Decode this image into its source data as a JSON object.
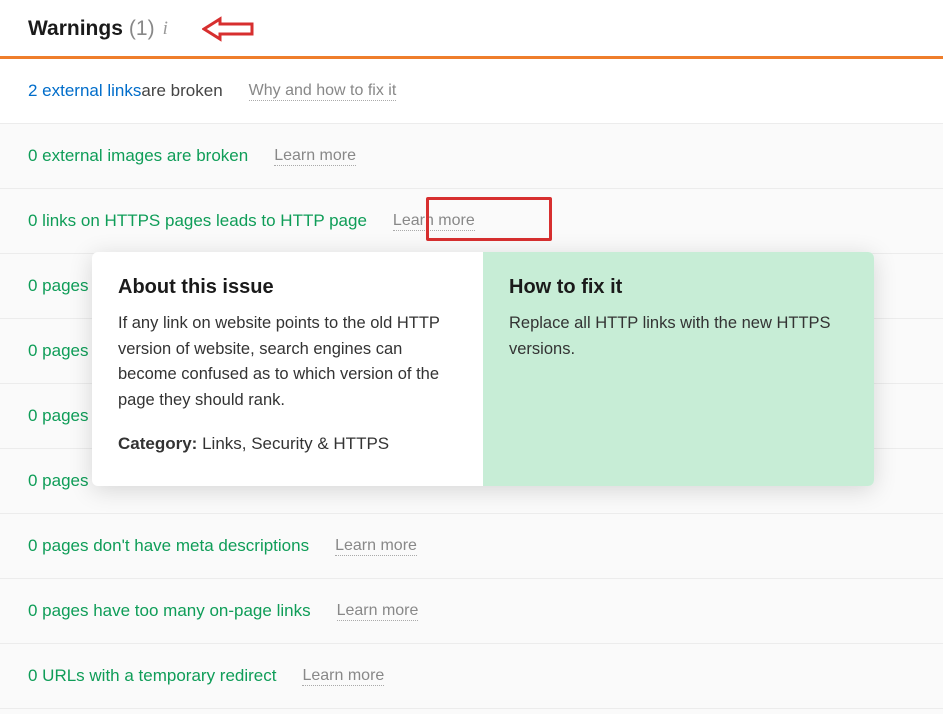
{
  "header": {
    "title": "Warnings",
    "count": "(1)"
  },
  "rows": [
    {
      "count_text": "2 external links",
      "suffix": " are broken",
      "action": "Why and how to fix it",
      "is_link": true
    },
    {
      "count_text": "0 external images are broken",
      "action": "Learn more",
      "is_link": false
    },
    {
      "count_text": "0 links on HTTPS pages leads to HTTP page",
      "action": "Learn more",
      "is_link": false,
      "highlighted": true
    },
    {
      "count_text": "0 pages",
      "action": "",
      "is_link": false
    },
    {
      "count_text": "0 pages",
      "action": "",
      "is_link": false
    },
    {
      "count_text": "0 pages",
      "action": "",
      "is_link": false
    },
    {
      "count_text": "0 pages",
      "action": "",
      "is_link": false
    },
    {
      "count_text": "0 pages don't have meta descriptions",
      "action": "Learn more",
      "is_link": false
    },
    {
      "count_text": "0 pages have too many on-page links",
      "action": "Learn more",
      "is_link": false
    },
    {
      "count_text": "0 URLs with a temporary redirect",
      "action": "Learn more",
      "is_link": false
    }
  ],
  "tooltip": {
    "about_title": "About this issue",
    "about_body": "If any link on website points to the old HTTP version of website, search engines can become confused as to which version of the page they should rank.",
    "category_label": "Category:",
    "category_value": " Links, Security & HTTPS",
    "fix_title": "How to fix it",
    "fix_body": "Replace all HTTP links with the new HTTPS versions."
  }
}
